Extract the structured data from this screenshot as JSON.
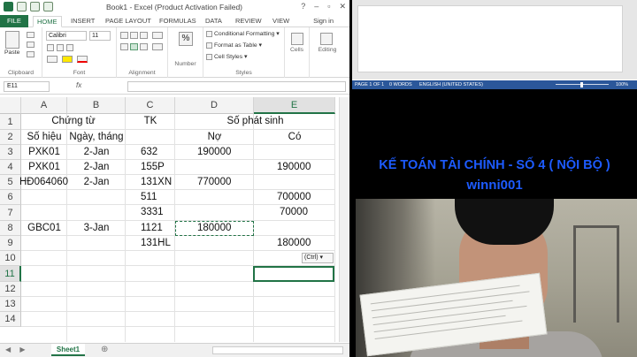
{
  "excel": {
    "doc_title": "Book1 -  Excel (Product Activation Failed)",
    "window_controls": [
      "?",
      "–",
      "▫",
      "✕"
    ],
    "tabs": [
      {
        "label": "FILE",
        "kind": "file"
      },
      {
        "label": "HOME",
        "kind": "active"
      },
      {
        "label": "INSERT",
        "kind": ""
      },
      {
        "label": "PAGE LAYOUT",
        "kind": ""
      },
      {
        "label": "FORMULAS",
        "kind": ""
      },
      {
        "label": "DATA",
        "kind": ""
      },
      {
        "label": "REVIEW",
        "kind": ""
      },
      {
        "label": "VIEW",
        "kind": ""
      }
    ],
    "signin": "Sign in",
    "ribbon": {
      "clipboard": {
        "paste": "Paste",
        "label": "Clipboard"
      },
      "font": {
        "name": "Calibri",
        "size": "11",
        "label": "Font"
      },
      "alignment": {
        "label": "Alignment"
      },
      "number": {
        "symbol": "%",
        "label": "Number"
      },
      "styles": {
        "conditional": "Conditional Formatting ▾",
        "format_table": "Format as Table ▾",
        "cell_styles": "Cell Styles ▾",
        "label": "Styles"
      },
      "cells": {
        "label": "Cells"
      },
      "editing": {
        "label": "Editing"
      }
    },
    "formula_bar": {
      "name_box": "E11",
      "fx": "fx",
      "content": ""
    },
    "columns": [
      "A",
      "B",
      "C",
      "D",
      "E"
    ],
    "rows": [
      "1",
      "2",
      "3",
      "4",
      "5",
      "6",
      "7",
      "8",
      "9",
      "10",
      "11",
      "12",
      "13",
      "14"
    ],
    "cells": {
      "chung_tu": "Chứng từ",
      "tk": "TK",
      "so_phat_sinh": "Số phát sinh",
      "so_hieu": "Số hiệu",
      "ngay_thang": "Ngày, tháng",
      "no": "Nợ",
      "co": "Có",
      "r3": {
        "a": "PXK01",
        "b": "2-Jan",
        "c": "632",
        "d": "190000",
        "e": ""
      },
      "r4": {
        "a": "PXK01",
        "b": "2-Jan",
        "c": "155P",
        "d": "",
        "e": "190000"
      },
      "r5": {
        "a": "HĐ064060",
        "b": "2-Jan",
        "c": "131XN",
        "d": "770000",
        "e": ""
      },
      "r6": {
        "a": "",
        "b": "",
        "c": "511",
        "d": "",
        "e": "700000"
      },
      "r7": {
        "a": "",
        "b": "",
        "c": "3331",
        "d": "",
        "e": "70000"
      },
      "r8": {
        "a": "GBC01",
        "b": "3-Jan",
        "c": "1121",
        "d": "180000",
        "e": ""
      },
      "r9": {
        "a": "",
        "b": "",
        "c": "131HL",
        "d": "",
        "e": "180000"
      }
    },
    "paste_options": "(Ctrl) ▾",
    "sheet_tab": "Sheet1",
    "add_sheet": "⊕",
    "nav_arrows": "◀ ▶"
  },
  "word": {
    "status": {
      "page": "PAGE 1 OF 1",
      "words": "0 WORDS",
      "language": "ENGLISH (UNITED STATES)",
      "zoom": "100%"
    }
  },
  "video": {
    "caption_line1": "KẾ TOÁN TÀI CHÍNH - SỐ 4 ( NỘI BỘ )",
    "caption_line2": "winni001"
  },
  "colors": {
    "excel_green": "#217346",
    "word_blue": "#2b579a",
    "caption_blue": "#1d5bff"
  }
}
